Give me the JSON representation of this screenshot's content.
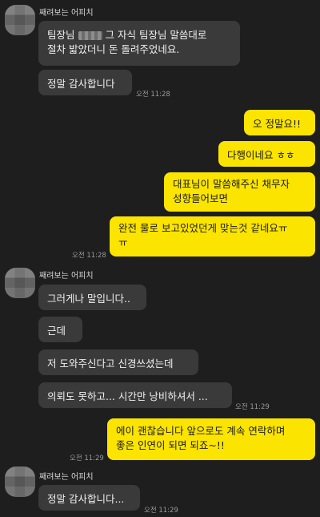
{
  "colors": {
    "background": "#1e1e1e",
    "incoming_bubble": "#3a3a3a",
    "outgoing_bubble": "#fbe400"
  },
  "sender_name": "째려보는 어피치",
  "group1": {
    "msg1_part1": "팀장님",
    "msg1_part2": "그 자식 팀장님 말씀대로",
    "msg1_line2": "절차 밟았더니 돈 돌려주었네요.",
    "msg2": "정말 감사합니다",
    "time": "오전 11:28"
  },
  "outgoing1": {
    "msg1": "오 정말요!!",
    "msg2": "다행이네요 ㅎㅎ",
    "msg3_line1": "대표님이 말씀해주신 채무자",
    "msg3_line2": "성향들어보면",
    "msg4_line1": "완전 물로 보고있었던게 맞는것 같네요ㅠ",
    "msg4_line2": "ㅠ",
    "time": "오전 11:28"
  },
  "group2": {
    "msg1": "그러게나 말입니다..",
    "msg2": "근데",
    "msg3": "저 도와주신다고 신경쓰셨는데",
    "msg4": "의뢰도 못하고... 시간만 낭비하셔서 ...",
    "time": "오전 11:29"
  },
  "outgoing2": {
    "msg1_line1": "에이 괜찮습니다 앞으로도 계속 연락하며",
    "msg1_line2": "좋은 인연이 되면 되죠~!!",
    "time": "오전 11:29"
  },
  "group3": {
    "msg1": "정말 감사합니다...",
    "time": "오전 11:29"
  }
}
